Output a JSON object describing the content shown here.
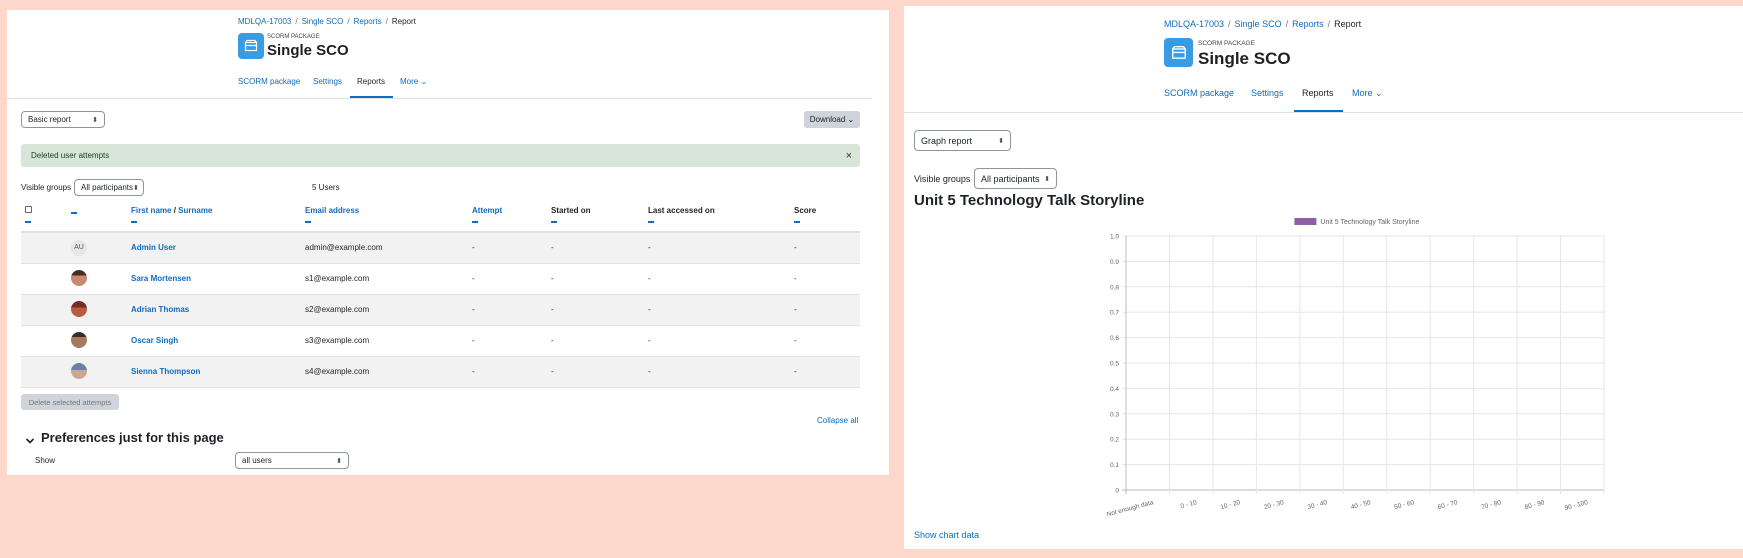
{
  "left": {
    "breadcrumb": [
      "MDLQA-17003",
      "Single SCO",
      "Reports",
      "Report"
    ],
    "module_label": "SCORM PACKAGE",
    "title": "Single SCO",
    "tabs": [
      {
        "label": "SCORM package"
      },
      {
        "label": "Settings"
      },
      {
        "label": "Reports"
      },
      {
        "label": "More ⌄"
      }
    ],
    "report_select": "Basic report",
    "download_label": "Download ⌄",
    "alert_text": "Deleted user attempts",
    "alert_close": "×",
    "groups_label": "Visible groups",
    "groups_select": "All participants",
    "users_count": "5 Users",
    "columns": {
      "first_name": "First name",
      "slash": " / ",
      "surname": "Surname",
      "email": "Email address",
      "attempt": "Attempt",
      "started": "Started on",
      "last_accessed": "Last accessed on",
      "score": "Score"
    },
    "rows": [
      {
        "initials": "AU",
        "name": "Admin User",
        "email": "admin@example.com",
        "attempt": "-",
        "started": "-",
        "last": "-",
        "score": "-"
      },
      {
        "initials": "",
        "name": "Sara Mortensen",
        "email": "s1@example.com",
        "attempt": "-",
        "started": "-",
        "last": "-",
        "score": "-"
      },
      {
        "initials": "",
        "name": "Adrian Thomas",
        "email": "s2@example.com",
        "attempt": "-",
        "started": "-",
        "last": "-",
        "score": "-"
      },
      {
        "initials": "",
        "name": "Oscar Singh",
        "email": "s3@example.com",
        "attempt": "-",
        "started": "-",
        "last": "-",
        "score": "-"
      },
      {
        "initials": "",
        "name": "Sienna Thompson",
        "email": "s4@example.com",
        "attempt": "-",
        "started": "-",
        "last": "-",
        "score": "-"
      }
    ],
    "delete_button": "Delete selected attempts",
    "collapse_all": "Collapse all",
    "prefs_heading": "Preferences just for this page",
    "show_label": "Show",
    "show_select": "all users"
  },
  "right": {
    "breadcrumb": [
      "MDLQA-17003",
      "Single SCO",
      "Reports",
      "Report"
    ],
    "module_label": "SCORM PACKAGE",
    "title": "Single SCO",
    "tabs": [
      {
        "label": "SCORM package"
      },
      {
        "label": "Settings"
      },
      {
        "label": "Reports"
      },
      {
        "label": "More ⌄"
      }
    ],
    "report_select": "Graph report",
    "groups_label": "Visible groups",
    "groups_select": "All participants",
    "heading": "Unit 5 Technology Talk Storyline",
    "show_chart_data": "Show chart data"
  },
  "chart_data": {
    "type": "bar",
    "categories": [
      "Not enough data",
      "0 - 10",
      "10 - 20",
      "20 - 30",
      "30 - 40",
      "40 - 50",
      "50 - 60",
      "60 - 70",
      "70 - 80",
      "80 - 90",
      "90 - 100"
    ],
    "series": [
      {
        "name": "Unit 5 Technology Talk Storyline",
        "values": [
          0,
          0,
          0,
          0,
          0,
          0,
          0,
          0,
          0,
          0,
          0
        ]
      }
    ],
    "ylim": [
      0,
      1.0
    ],
    "yticks": [
      "0",
      "0.1",
      "0.2",
      "0.3",
      "0.4",
      "0.5",
      "0.6",
      "0.7",
      "0.8",
      "0.9",
      "1.0"
    ],
    "legend_position": "top",
    "series_color": "#8e5ea2",
    "grid": true
  },
  "colors": {
    "accent": "#0f6cbf",
    "module_icon": "#399be2",
    "alert_bg": "#d7e6d9",
    "background": "#fdd6cc"
  }
}
